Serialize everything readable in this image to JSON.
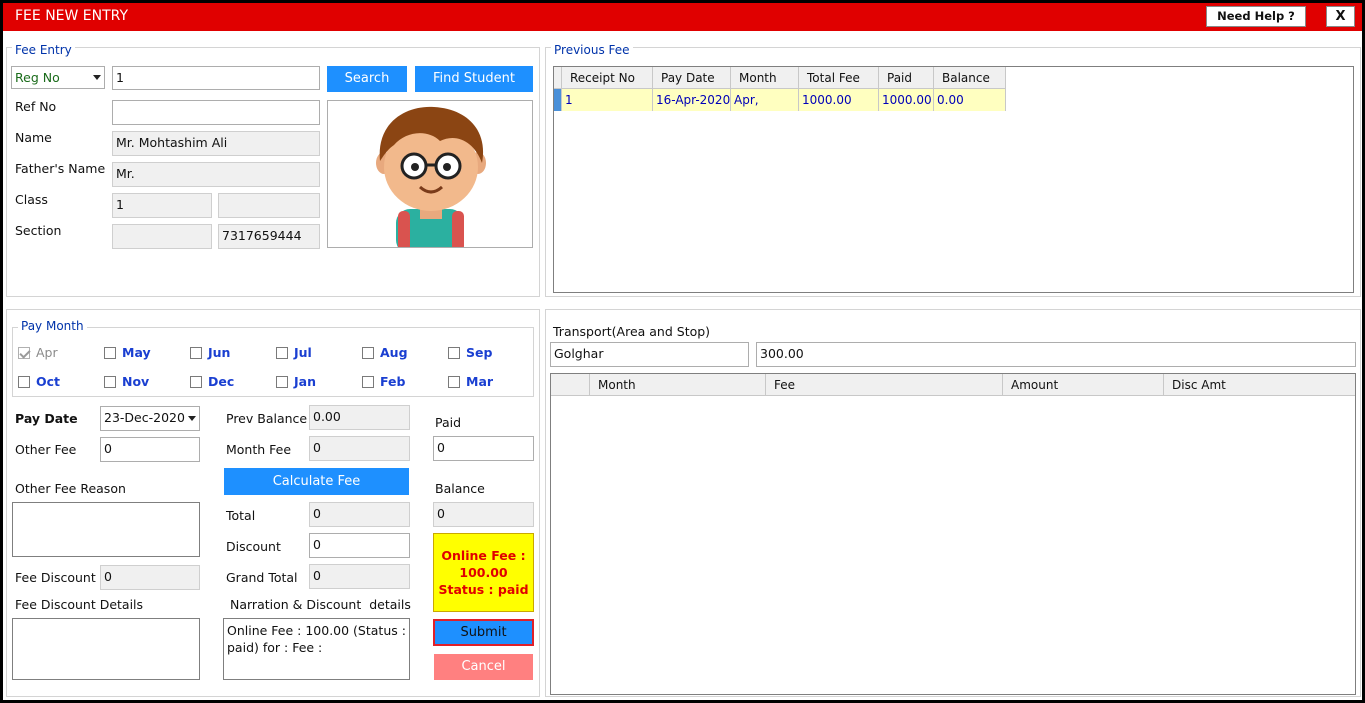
{
  "window": {
    "title": "FEE NEW ENTRY",
    "help_label": "Need Help ?",
    "close_label": "X"
  },
  "fee_entry": {
    "legend": "Fee Entry",
    "reg_select": "Reg No",
    "reg_value": "1",
    "search_label": "Search",
    "find_label": "Find Student",
    "ref_label": "Ref No",
    "ref_value": "",
    "name_label": "Name",
    "name_value": "Mr. Mohtashim Ali",
    "father_label": "Father's Name",
    "father_value": "Mr.",
    "class_label": "Class",
    "class_value": "1",
    "class_extra": "",
    "section_label": "Section",
    "section_value": "",
    "phone_value": "7317659444"
  },
  "previous_fee": {
    "legend": "Previous Fee",
    "columns": [
      "Receipt No",
      "Pay Date",
      "Month",
      "Total Fee",
      "Paid",
      "Balance"
    ],
    "rows": [
      [
        "1",
        "16-Apr-2020",
        "Apr,",
        "1000.00",
        "1000.00",
        "0.00"
      ]
    ]
  },
  "pay_month": {
    "legend": "Pay Month",
    "months": [
      {
        "label": "Apr",
        "checked": true,
        "disabled": true
      },
      {
        "label": "May",
        "checked": false,
        "disabled": false
      },
      {
        "label": "Jun",
        "checked": false,
        "disabled": false
      },
      {
        "label": "Jul",
        "checked": false,
        "disabled": false
      },
      {
        "label": "Aug",
        "checked": false,
        "disabled": false
      },
      {
        "label": "Sep",
        "checked": false,
        "disabled": false
      },
      {
        "label": "Oct",
        "checked": false,
        "disabled": false
      },
      {
        "label": "Nov",
        "checked": false,
        "disabled": false
      },
      {
        "label": "Dec",
        "checked": false,
        "disabled": false
      },
      {
        "label": "Jan",
        "checked": false,
        "disabled": false
      },
      {
        "label": "Feb",
        "checked": false,
        "disabled": false
      },
      {
        "label": "Mar",
        "checked": false,
        "disabled": false
      }
    ]
  },
  "payment": {
    "pay_date_label": "Pay Date",
    "pay_date_value": "23-Dec-2020",
    "other_fee_label": "Other Fee",
    "other_fee_value": "0",
    "other_fee_reason_label": "Other Fee Reason",
    "other_fee_reason_value": "",
    "fee_discount_label": "Fee Discount",
    "fee_discount_value": "0",
    "fee_discount_details_label": "Fee Discount Details",
    "fee_discount_details_value": "",
    "prev_balance_label": "Prev Balance",
    "prev_balance_value": "0.00",
    "month_fee_label": "Month Fee",
    "month_fee_value": "0",
    "calculate_label": "Calculate Fee",
    "total_label": "Total",
    "total_value": "0",
    "discount_label": "Discount",
    "discount_value": "0",
    "grand_total_label": "Grand Total",
    "grand_total_value": "0",
    "narration_label": "Narration & Discount  details",
    "narration_value": "Online Fee : 100.00 (Status : paid) for : Fee :",
    "paid_label": "Paid",
    "paid_value": "0",
    "balance_label": "Balance",
    "balance_value": "0",
    "online_status_line1": "Online Fee :",
    "online_status_line2": "100.00",
    "online_status_line3": "Status : paid",
    "submit_label": "Submit",
    "cancel_label": "Cancel"
  },
  "transport": {
    "label": "Transport(Area and Stop)",
    "area_value": "Golghar",
    "amount_value": "300.00",
    "columns": [
      "Month",
      "Fee",
      "Amount",
      "Disc Amt"
    ]
  },
  "colors": {
    "title_bar": "#e00000",
    "button": "#1e90ff",
    "cancel": "#ff8080",
    "online_box": "#ffff00",
    "online_text": "#e00000",
    "row_highlight": "#ffffc0",
    "month_text": "#1a3fd1"
  },
  "icons": {
    "student_photo": "student-cartoon-avatar",
    "dropdown": "chevron-down-icon",
    "close": "close-icon"
  }
}
